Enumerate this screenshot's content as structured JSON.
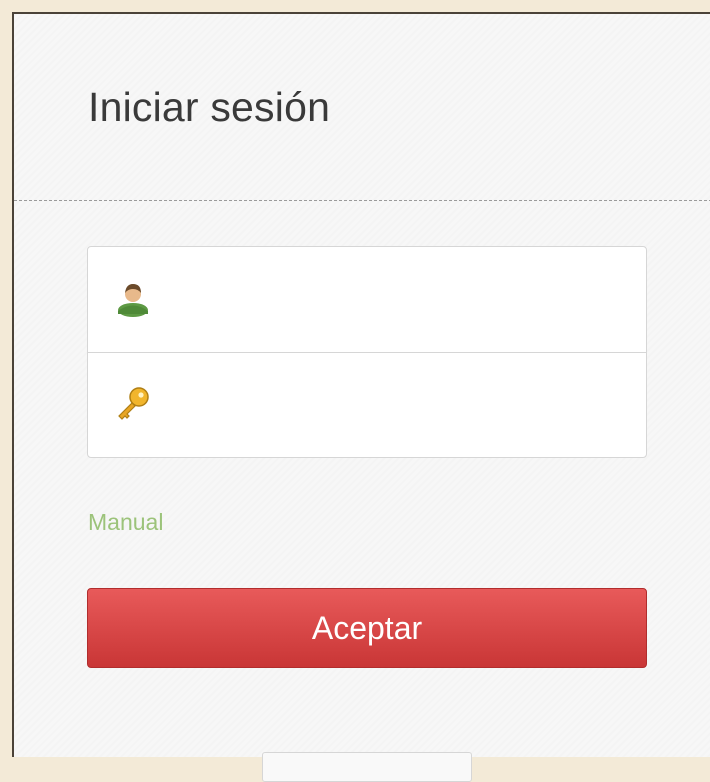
{
  "login": {
    "title": "Iniciar sesión",
    "username": {
      "icon": "user-icon",
      "value": "",
      "placeholder": ""
    },
    "password": {
      "icon": "key-icon",
      "value": "",
      "placeholder": ""
    },
    "manual_link": "Manual",
    "submit_label": "Aceptar"
  },
  "colors": {
    "background": "#f3ead7",
    "panel": "#f7f7f7",
    "link": "#9cc37a",
    "button": "#d94444"
  }
}
